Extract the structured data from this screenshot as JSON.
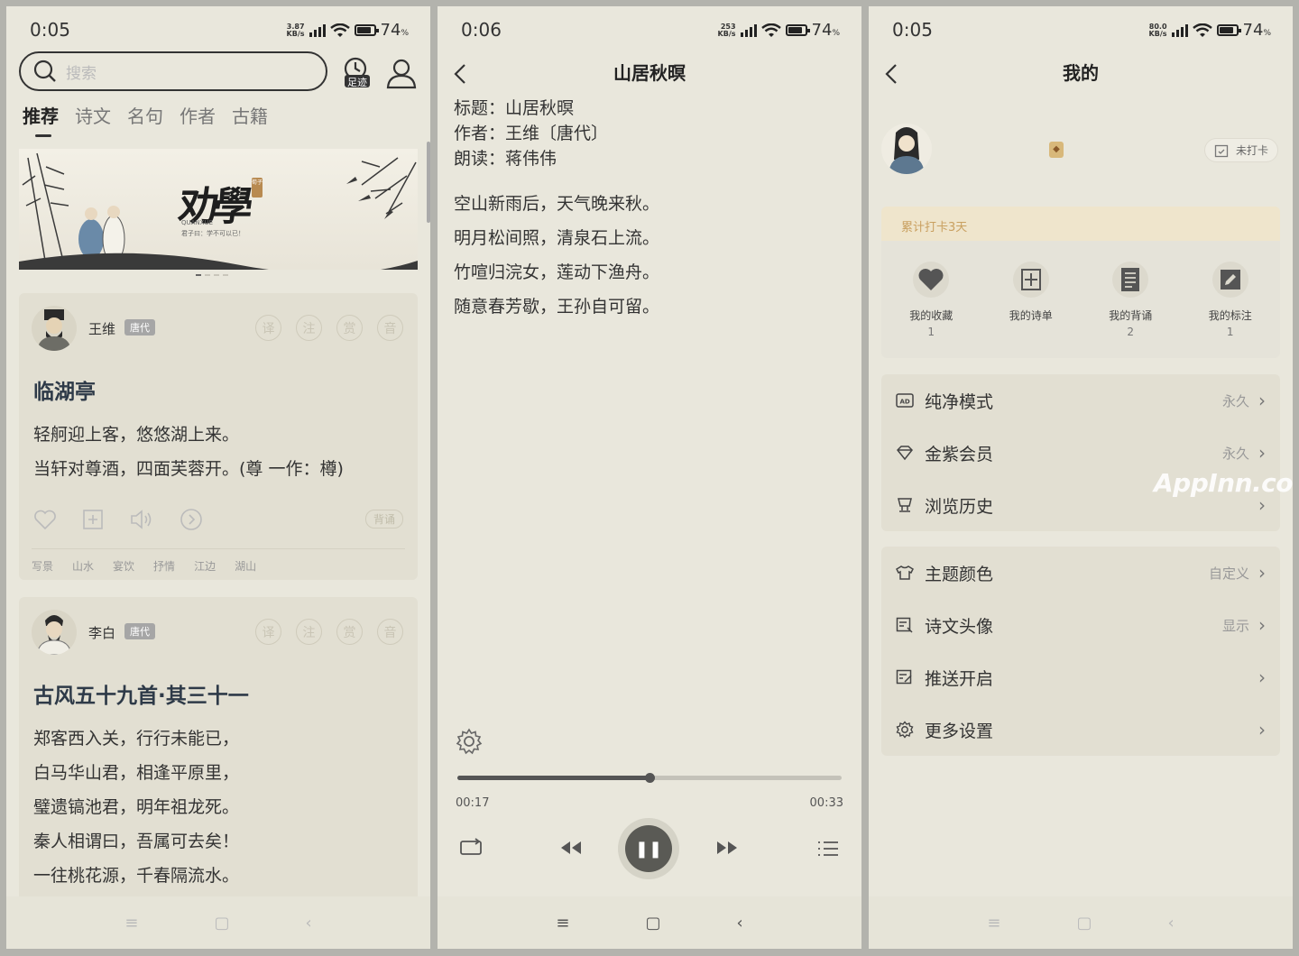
{
  "phone1": {
    "status": {
      "time": "0:05",
      "speed": "3.87",
      "speed_unit": "KB/s",
      "battery": "74",
      "battery_unit": "%"
    },
    "search": {
      "placeholder": "搜索"
    },
    "footprint_label": "足迹",
    "tabs": [
      {
        "label": "推荐"
      },
      {
        "label": "诗文"
      },
      {
        "label": "名句"
      },
      {
        "label": "作者"
      },
      {
        "label": "古籍"
      }
    ],
    "banner": {
      "title": "劝學",
      "romanized": "QUANXUE",
      "quote": "君子曰：学不可以已！",
      "seal": "荀子"
    },
    "cards": [
      {
        "author": "王维",
        "dynasty": "唐代",
        "buttons": [
          "译",
          "注",
          "赏",
          "音"
        ],
        "title": "临湖亭",
        "lines": [
          "轻舸迎上客，悠悠湖上来。",
          "当轩对尊酒，四面芙蓉开。(尊 一作：樽)"
        ],
        "recite": "背诵",
        "tags": [
          "写景",
          "山水",
          "宴饮",
          "抒情",
          "江边",
          "湖山"
        ]
      },
      {
        "author": "李白",
        "dynasty": "唐代",
        "buttons": [
          "译",
          "注",
          "赏",
          "音"
        ],
        "title": "古风五十九首·其三十一",
        "lines": [
          "郑客西入关，行行未能已，",
          "白马华山君，相逢平原里，",
          "璧遗镐池君，明年祖龙死。",
          "秦人相谓曰，吾属可去矣！",
          "一往桃花源，千春隔流水。"
        ]
      }
    ],
    "nav": [
      "≡",
      "▢",
      "‹"
    ]
  },
  "phone2": {
    "status": {
      "time": "0:06",
      "speed": "253",
      "speed_unit": "KB/s",
      "battery": "74",
      "battery_unit": "%"
    },
    "title": "山居秋暝",
    "meta": [
      "标题：山居秋暝",
      "作者：王维〔唐代〕",
      "朗读：蒋伟伟"
    ],
    "lines": [
      "空山新雨后，天气晚来秋。",
      "明月松间照，清泉石上流。",
      "竹喧归浣女，莲动下渔舟。",
      "随意春芳歇，王孙自可留。"
    ],
    "player": {
      "current": "00:17",
      "total": "00:33",
      "progress": 0.5,
      "state_icon": "pause-icon",
      "pause_glyph": "❚❚"
    },
    "nav": [
      "≡",
      "▢",
      "‹"
    ]
  },
  "phone3": {
    "status": {
      "time": "0:05",
      "speed": "80.0",
      "speed_unit": "KB/s",
      "battery": "74",
      "battery_unit": "%"
    },
    "title": "我的",
    "checkin": "未打卡",
    "streak": "累计打卡3天",
    "stats": [
      {
        "label": "我的收藏",
        "value": "1",
        "icon": "heart-icon"
      },
      {
        "label": "我的诗单",
        "value": "",
        "icon": "plus-box-icon"
      },
      {
        "label": "我的背诵",
        "value": "2",
        "icon": "document-icon"
      },
      {
        "label": "我的标注",
        "value": "1",
        "icon": "edit-icon"
      }
    ],
    "group1": [
      {
        "label": "纯净模式",
        "value": "永久",
        "icon": "ad-icon"
      },
      {
        "label": "金紫会员",
        "value": "永久",
        "icon": "diamond-icon"
      },
      {
        "label": "浏览历史",
        "value": "",
        "icon": "cup-icon"
      }
    ],
    "group2": [
      {
        "label": "主题颜色",
        "value": "自定义",
        "icon": "shirt-icon"
      },
      {
        "label": "诗文头像",
        "value": "显示",
        "icon": "image-icon"
      },
      {
        "label": "推送开启",
        "value": "",
        "icon": "push-icon"
      },
      {
        "label": "更多设置",
        "value": "",
        "icon": "gear-icon"
      }
    ],
    "watermark": "AppInn.com",
    "nav": [
      "≡",
      "▢",
      "‹"
    ]
  },
  "colors": {
    "background": "#e9e7dc",
    "card": "#e2dfd2",
    "accent": "#2e3a48",
    "gold": "#c9a060"
  }
}
